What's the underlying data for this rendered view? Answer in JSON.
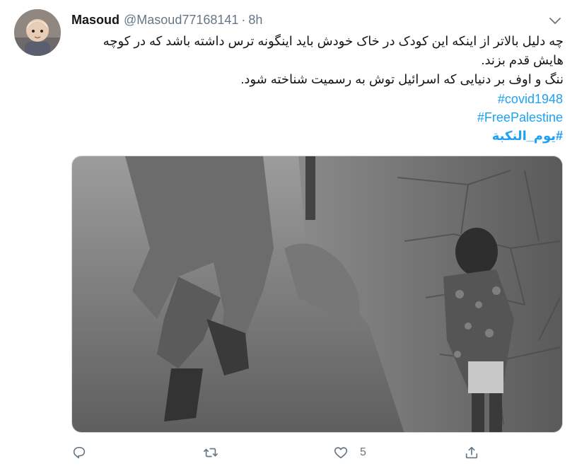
{
  "user": {
    "name": "Masoud",
    "handle": "@Masoud77168141",
    "separator": "·",
    "time": "8h"
  },
  "tweet": {
    "lines": [
      "چه دلیل بالاتر از اینکه این کودک در خاک خودش باید اینگونه ترس داشته باشد که در کوچه هایش قدم بزند.",
      "ننگ و اوف بر دنیایی که اسرائیل توش به رسمیت شناخته شود."
    ],
    "hashtags": [
      "#covid1948",
      "#FreePalestine",
      "#یوم_النكبة"
    ]
  },
  "actions": {
    "reply": {
      "icon": "reply-icon"
    },
    "retweet": {
      "icon": "retweet-icon"
    },
    "like": {
      "icon": "heart-icon",
      "count": "5"
    },
    "share": {
      "icon": "share-icon"
    }
  },
  "colors": {
    "link": "#1da1f2",
    "secondary": "#657786",
    "text": "#14171a"
  }
}
